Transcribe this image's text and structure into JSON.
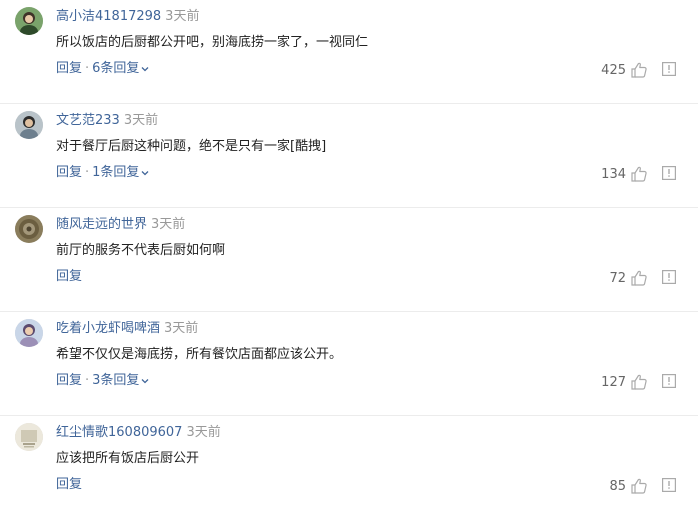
{
  "comments": [
    {
      "username": "高小洁41817298",
      "time": "3天前",
      "text": "所以饭店的后厨都公开吧，别海底捞一家了，一视同仁",
      "reply_label": "回复",
      "separator": "·",
      "replies_label": "6条回复",
      "likes": "425",
      "avatar_color": "#7aa36b"
    },
    {
      "username": "文艺范233",
      "time": "3天前",
      "text": "对于餐厅后厨这种问题，绝不是只有一家[酷拽]",
      "reply_label": "回复",
      "separator": "·",
      "replies_label": "1条回复",
      "likes": "134",
      "avatar_color": "#6d7f8e"
    },
    {
      "username": "随风走远的世界",
      "time": "3天前",
      "text": "前厅的服务不代表后厨如何啊",
      "reply_label": "回复",
      "likes": "72",
      "avatar_color": "#8a7d5c"
    },
    {
      "username": "吃着小龙虾喝啤酒",
      "time": "3天前",
      "text": "希望不仅仅是海底捞，所有餐饮店面都应该公开。",
      "reply_label": "回复",
      "separator": "·",
      "replies_label": "3条回复",
      "likes": "127",
      "avatar_color": "#9b8fb6"
    },
    {
      "username": "红尘情歌160809607",
      "time": "3天前",
      "text": "应该把所有饭店后厨公开",
      "reply_label": "回复",
      "likes": "85",
      "avatar_color": "#cfc9b5"
    }
  ],
  "icons": {
    "like": "thumbs-up-icon",
    "report": "report-icon",
    "expand": "chevron-down-icon"
  },
  "colors": {
    "link": "#406599",
    "muted": "#999999",
    "text": "#222222",
    "divider": "#ececec"
  }
}
